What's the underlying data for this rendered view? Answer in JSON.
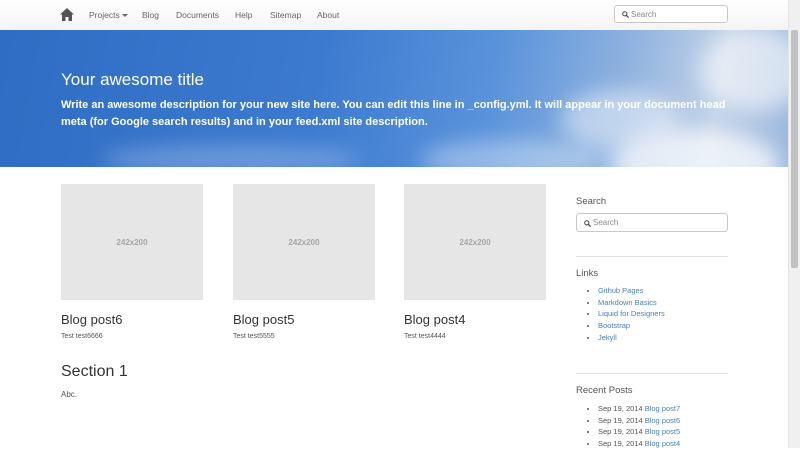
{
  "nav": {
    "items": [
      {
        "label": "Projects",
        "dropdown": true
      },
      {
        "label": "Blog"
      },
      {
        "label": "Documents"
      },
      {
        "label": "Help"
      },
      {
        "label": "Sitemap"
      },
      {
        "label": "About"
      }
    ],
    "search_placeholder": "Search"
  },
  "hero": {
    "title": "Your awesome title",
    "description": "Write an awesome description for your new site here. You can edit this line in _config.yml. It will appear in your document head meta (for Google search results) and in your feed.xml site description."
  },
  "posts": [
    {
      "placeholder": "242x200",
      "title": "Blog post6",
      "excerpt": "Test test6666"
    },
    {
      "placeholder": "242x200",
      "title": "Blog post5",
      "excerpt": "Test test5555"
    },
    {
      "placeholder": "242x200",
      "title": "Blog post4",
      "excerpt": "Test test4444"
    }
  ],
  "section": {
    "title": "Section 1",
    "body": "Abc."
  },
  "sidebar": {
    "search_heading": "Search",
    "search_placeholder": "Search",
    "links_heading": "Links",
    "links": [
      "Github Pages",
      "Markdown Basics",
      "Liquid for Designers",
      "Bootstrap",
      "Jekyll"
    ],
    "recent_heading": "Recent Posts",
    "recent": [
      {
        "date": "Sep 19, 2014",
        "title": "Blog post7"
      },
      {
        "date": "Sep 19, 2014",
        "title": "Blog post6"
      },
      {
        "date": "Sep 19, 2014",
        "title": "Blog post5"
      },
      {
        "date": "Sep 19, 2014",
        "title": "Blog post4"
      }
    ]
  },
  "colors": {
    "link": "#4a7fb5",
    "hero_blue": "#2f6cc3"
  }
}
